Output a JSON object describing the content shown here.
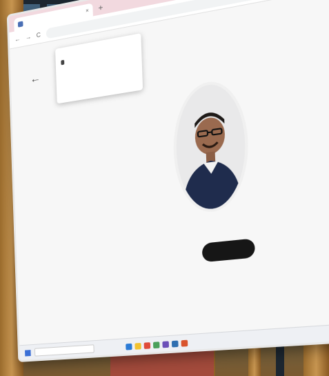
{
  "browser": {
    "tab_title": "",
    "tab_close": "×",
    "new_tab": "+",
    "address": "",
    "nav_back": "←",
    "nav_forward": "→",
    "nav_reload": "C"
  },
  "page": {
    "back_icon": "←",
    "title": "",
    "subtitle": ""
  },
  "popup": {
    "heading": "",
    "device": "",
    "cancel": "",
    "allow": ""
  },
  "join_button": {
    "label": ""
  },
  "footer": {
    "text": ""
  },
  "taskbar": {
    "search_placeholder": ""
  },
  "colors": {
    "tab_strip": "#f2d9df",
    "join_button": "#161616",
    "wall_wood": "#c79550",
    "window_glass": "#41627d"
  }
}
